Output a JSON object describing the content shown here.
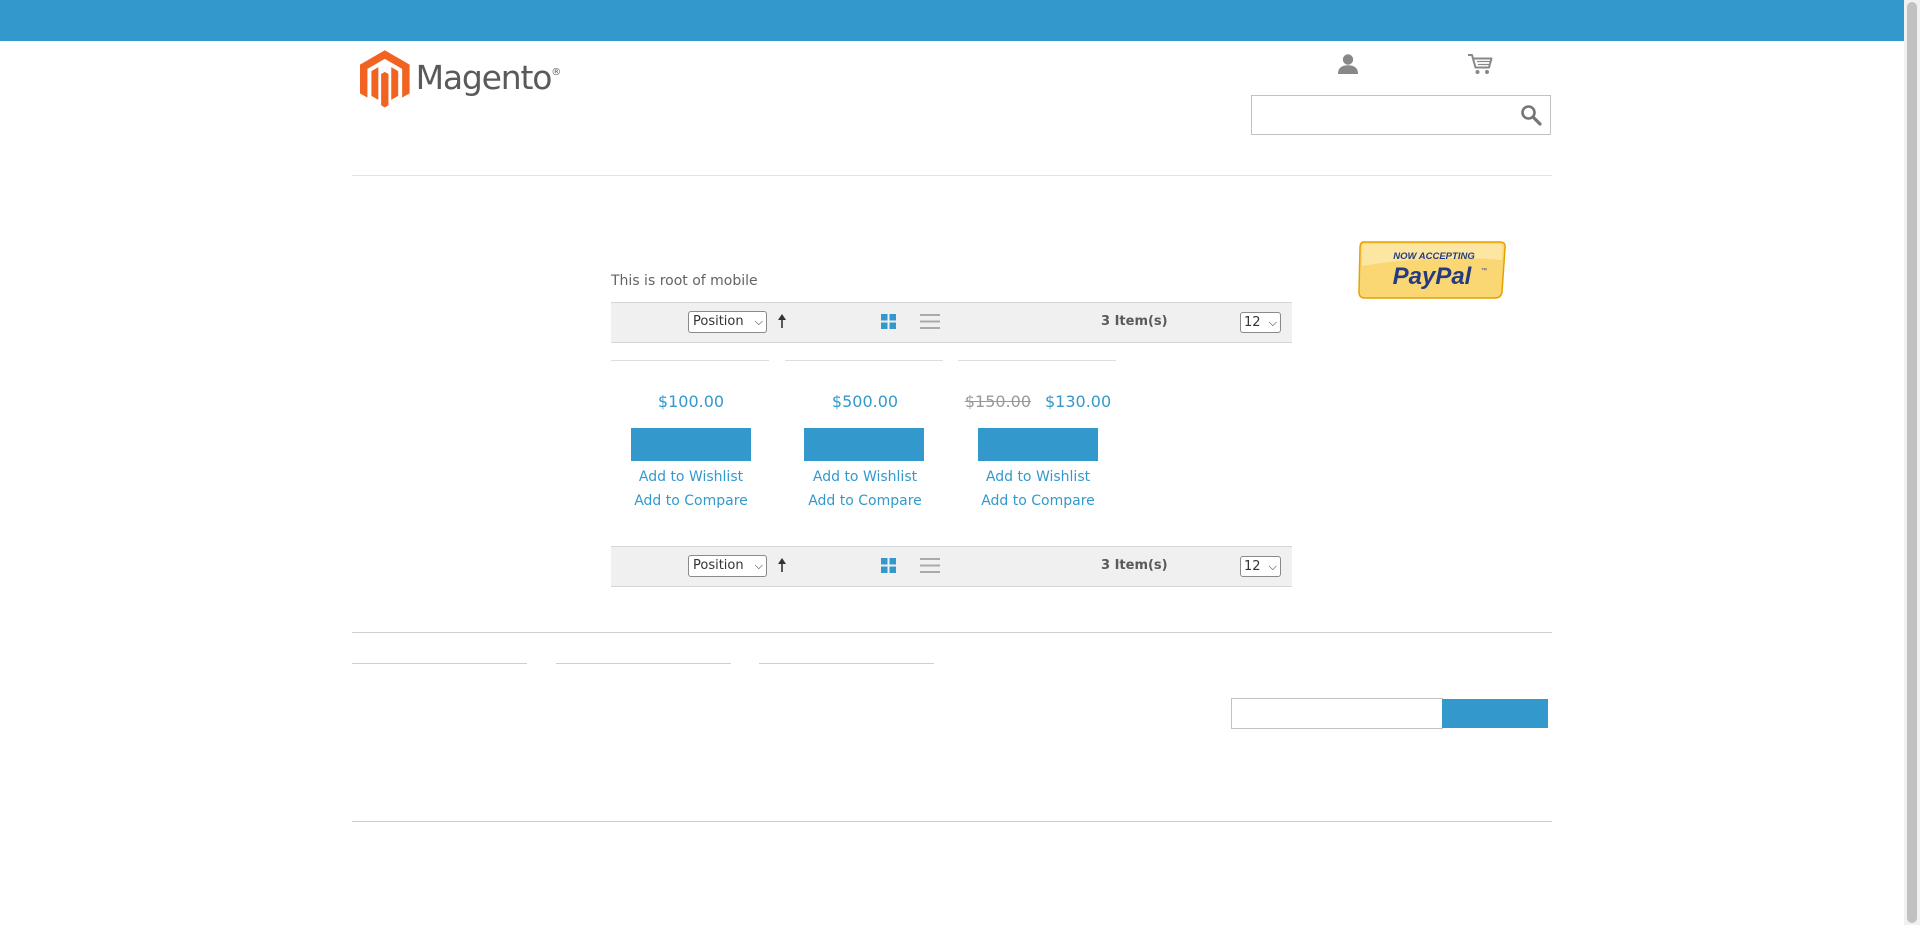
{
  "header": {
    "logo_text": "Magento",
    "logo_reg": "®",
    "account_icon": "account-icon",
    "cart_icon": "cart-icon",
    "search_icon": "search-icon",
    "search_placeholder": ""
  },
  "sidebar": {
    "banner_alt": "Now Accepting PayPal",
    "banner_line1": "NOW ACCEPTING",
    "banner_line2": "PayPal",
    "banner_tm": "™"
  },
  "category": {
    "description": "This is root of mobile"
  },
  "toolbar_top": {
    "sort_value": "Position",
    "item_count": "3 Item(s)",
    "limit_value": "12"
  },
  "toolbar_bottom": {
    "sort_value": "Position",
    "item_count": "3 Item(s)",
    "limit_value": "12"
  },
  "products": [
    {
      "price": "$100.00",
      "old_price": "",
      "wishlist": "Add to Wishlist",
      "compare": "Add to Compare"
    },
    {
      "price": "$500.00",
      "old_price": "",
      "wishlist": "Add to Wishlist",
      "compare": "Add to Compare"
    },
    {
      "price": "$130.00",
      "old_price": "$150.00",
      "wishlist": "Add to Wishlist",
      "compare": "Add to Compare"
    }
  ],
  "colors": {
    "accent": "#3399cc",
    "logo_orange": "#f26322",
    "toolbar_bg": "#f0f0f0"
  }
}
